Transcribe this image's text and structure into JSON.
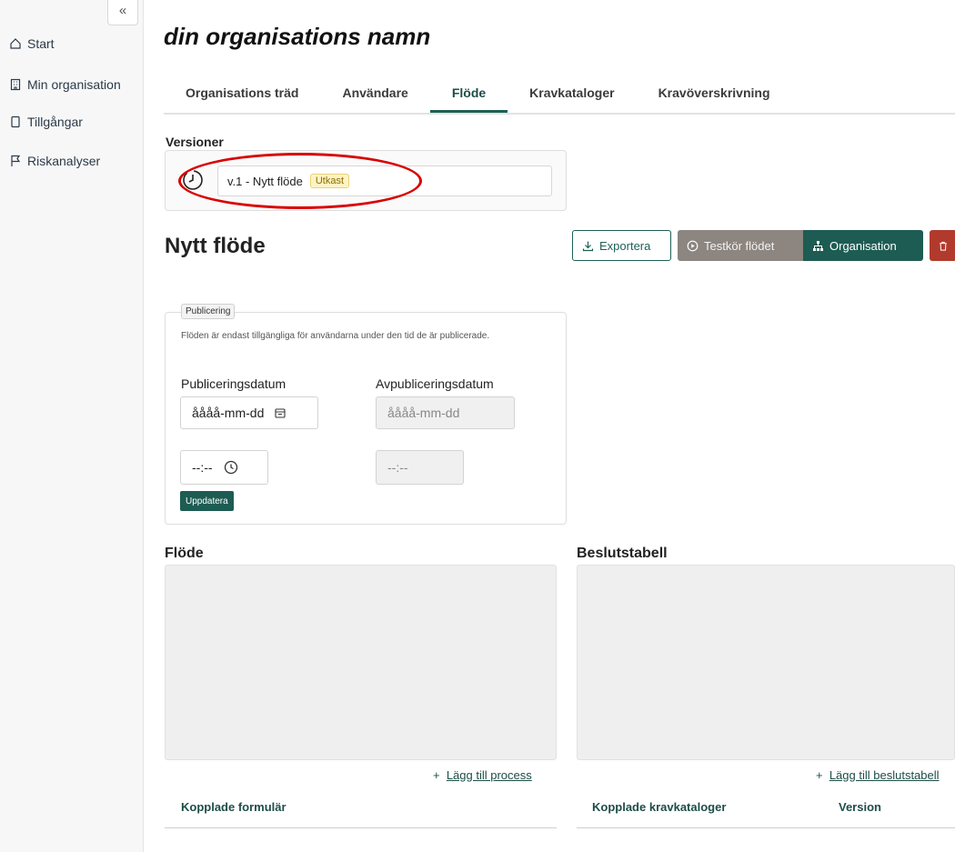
{
  "sidebar": {
    "collapse_label": "«",
    "items": [
      {
        "label": "Start",
        "icon": "home-icon"
      },
      {
        "label": "Min organisation",
        "icon": "building-icon"
      },
      {
        "label": "Tillgångar",
        "icon": "document-icon"
      },
      {
        "label": "Riskanalyser",
        "icon": "flag-icon"
      }
    ]
  },
  "header": {
    "org_name": "din organisations namn"
  },
  "tabs": [
    {
      "label": "Organisations träd",
      "active": false
    },
    {
      "label": "Användare",
      "active": false
    },
    {
      "label": "Flöde",
      "active": true
    },
    {
      "label": "Kravkataloger",
      "active": false
    },
    {
      "label": "Kravöverskrivning",
      "active": false
    }
  ],
  "versions": {
    "label": "Versioner",
    "selected": "v.1 - Nytt flöde",
    "badge": "Utkast"
  },
  "flow": {
    "title": "Nytt flöde",
    "export_label": "Exportera",
    "test_label": "Testkör flödet",
    "org_label": "Organisation"
  },
  "publishing": {
    "legend": "Publicering",
    "note": "Flöden är endast tillgängliga för användarna under den tid de är publicerade.",
    "publish_date_label": "Publiceringsdatum",
    "unpublish_date_label": "Avpubliceringsdatum",
    "date_placeholder": "åååå-mm-dd",
    "time_placeholder": "--:--",
    "update_label": "Uppdatera"
  },
  "sections": {
    "flow_title": "Flöde",
    "decision_title": "Beslutstabell",
    "add_process": "Lägg till process",
    "add_decision": "Lägg till beslutstabell",
    "linked_forms": "Kopplade formulär",
    "linked_catalogs": "Kopplade kravkataloger",
    "version_col": "Version"
  },
  "colors": {
    "primary": "#1d5c53",
    "highlight": "#d90000",
    "delete": "#b23a2c"
  }
}
